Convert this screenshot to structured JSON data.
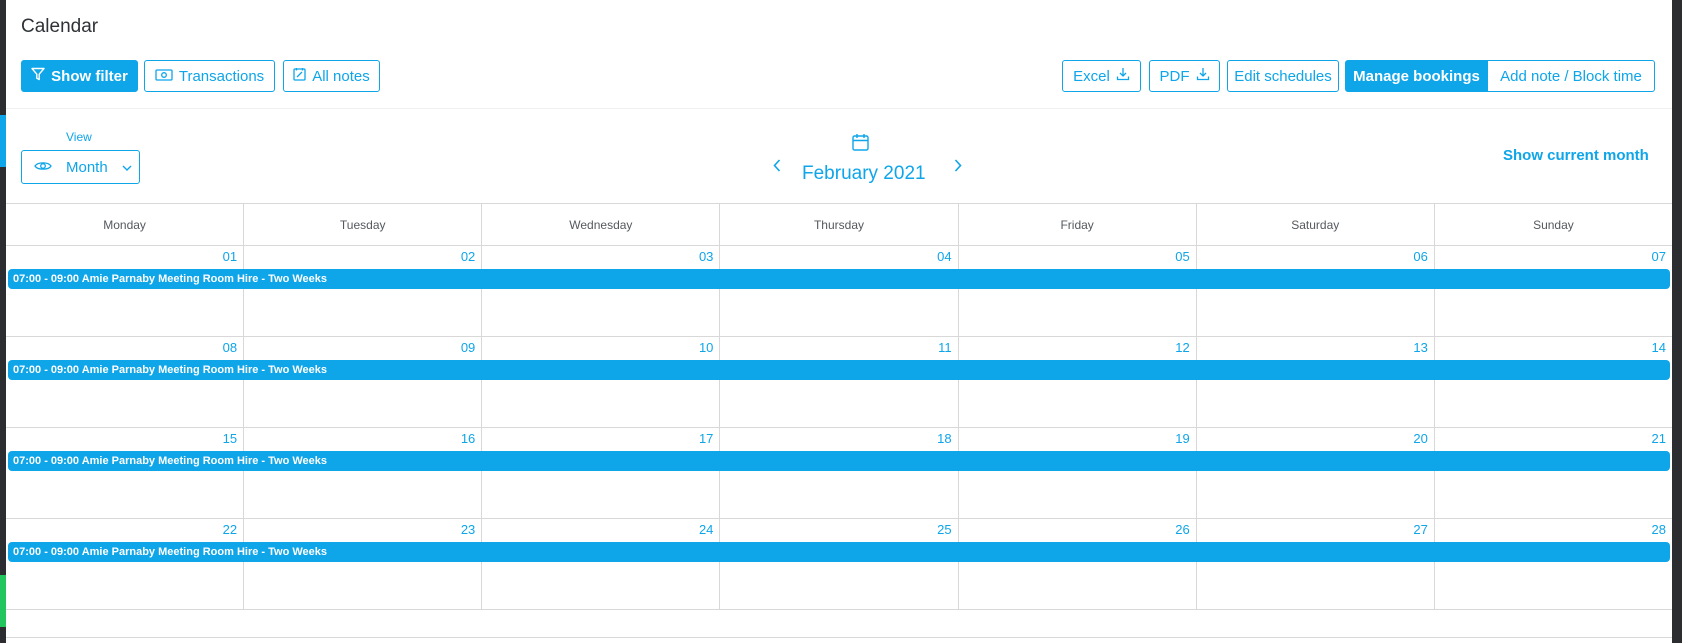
{
  "page_title": "Calendar",
  "toolbar": {
    "show_filter": "Show filter",
    "transactions": "Transactions",
    "all_notes": "All notes",
    "excel": "Excel",
    "pdf": "PDF",
    "edit_schedules": "Edit schedules",
    "manage_bookings": "Manage bookings",
    "add_note": "Add note / Block time"
  },
  "view": {
    "label": "View",
    "value": "Month"
  },
  "navigation": {
    "month_label": "February 2021",
    "show_current": "Show current month"
  },
  "weekdays": [
    "Monday",
    "Tuesday",
    "Wednesday",
    "Thursday",
    "Friday",
    "Saturday",
    "Sunday"
  ],
  "weeks": [
    {
      "days": [
        "01",
        "02",
        "03",
        "04",
        "05",
        "06",
        "07"
      ],
      "event": "07:00 - 09:00 Amie Parnaby Meeting Room Hire - Two Weeks"
    },
    {
      "days": [
        "08",
        "09",
        "10",
        "11",
        "12",
        "13",
        "14"
      ],
      "event": "07:00 - 09:00 Amie Parnaby Meeting Room Hire - Two Weeks"
    },
    {
      "days": [
        "15",
        "16",
        "17",
        "18",
        "19",
        "20",
        "21"
      ],
      "event": "07:00 - 09:00 Amie Parnaby Meeting Room Hire - Two Weeks"
    },
    {
      "days": [
        "22",
        "23",
        "24",
        "25",
        "26",
        "27",
        "28"
      ],
      "event": "07:00 - 09:00 Amie Parnaby Meeting Room Hire - Two Weeks"
    }
  ],
  "colors": {
    "accent": "#0ea5e9",
    "grid": "#d8d8d8",
    "text": "#2f3337"
  },
  "icons": [
    "filter-icon",
    "money-icon",
    "notes-icon",
    "download-icon",
    "eye-icon",
    "chevron-down-icon",
    "calendar-icon",
    "chevron-left-icon",
    "chevron-right-icon"
  ]
}
